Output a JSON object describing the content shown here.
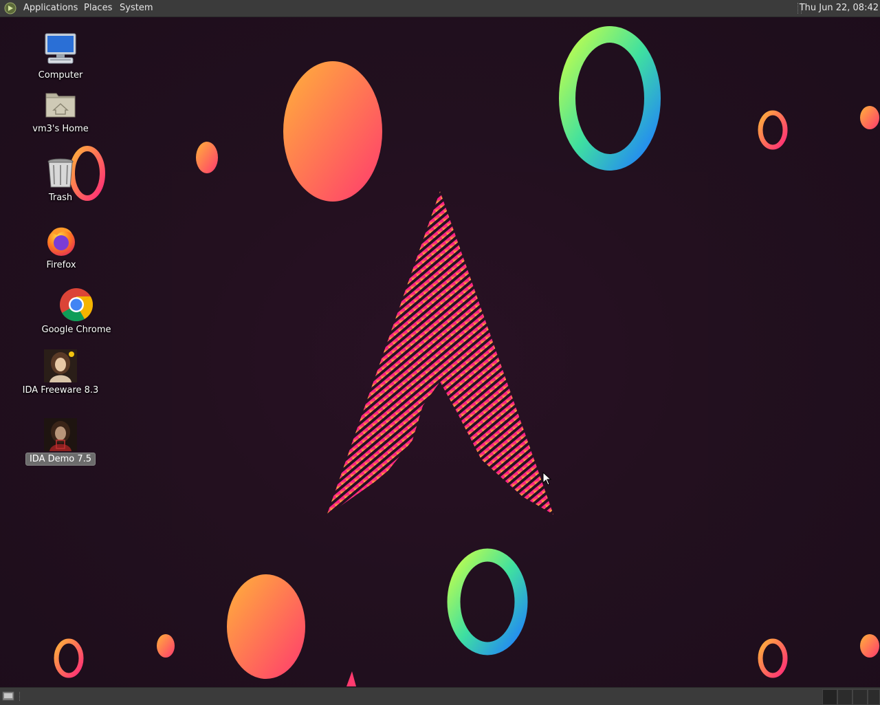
{
  "top_panel": {
    "menus": {
      "applications": "Applications",
      "places": "Places",
      "system": "System"
    },
    "clock": "Thu Jun 22, 08:42"
  },
  "desktop": {
    "icons": [
      {
        "label": "Computer",
        "icon": "computer-icon"
      },
      {
        "label": "vm3's Home",
        "icon": "home-folder-icon"
      },
      {
        "label": "Trash",
        "icon": "trash-icon"
      },
      {
        "label": "Firefox",
        "icon": "firefox-icon"
      },
      {
        "label": "Google Chrome",
        "icon": "chrome-icon"
      },
      {
        "label": "IDA Freeware 8.3",
        "icon": "ida-freeware-icon"
      },
      {
        "label": "IDA Demo 7.5",
        "icon": "ida-demo-icon",
        "selected": true
      }
    ]
  },
  "bottom_panel": {
    "workspaces": 4,
    "active_workspace": 1
  },
  "colors": {
    "panel": "#3b3b3b",
    "background": "#230f20",
    "accent_pink": "#ff1e8a",
    "accent_orange": "#ffa53a"
  }
}
